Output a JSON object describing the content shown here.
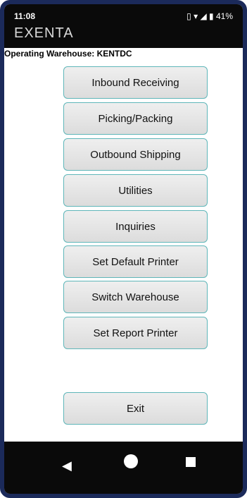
{
  "status_bar": {
    "time": "11:08",
    "battery": "41%",
    "icons": [
      "vibrate-icon",
      "wifi-icon",
      "signal-icon",
      "battery-icon"
    ]
  },
  "brand": {
    "name": "EXENTA"
  },
  "warehouse": {
    "label": "Operating Warehouse: KENTDC"
  },
  "menu": {
    "items": [
      {
        "label": "Inbound Receiving"
      },
      {
        "label": "Picking/Packing"
      },
      {
        "label": "Outbound Shipping"
      },
      {
        "label": "Utilities"
      },
      {
        "label": "Inquiries"
      },
      {
        "label": "Set Default Printer"
      },
      {
        "label": "Switch Warehouse"
      },
      {
        "label": "Set Report Printer"
      }
    ],
    "exit_label": "Exit"
  },
  "nav": {
    "back": "◀",
    "home": "home-icon",
    "recent": "recent-icon"
  },
  "colors": {
    "button_border": "#5fb6b9",
    "button_bg": "#e6e6e6",
    "bar_bg": "#0a0a0a"
  }
}
